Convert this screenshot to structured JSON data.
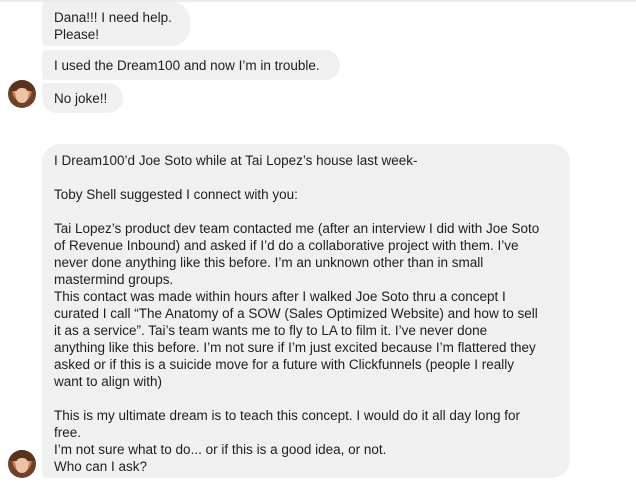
{
  "messages": [
    {
      "text": "Dana!!! I need help.\nPlease!"
    },
    {
      "text": "I used the Dream100 and now I’m in trouble."
    },
    {
      "text": "No joke!!"
    },
    {
      "text": "I Dream100’d Joe Soto while at Tai Lopez’s house last week-\n\nToby Shell suggested I connect with you:\n\nTai Lopez’s product dev team contacted me (after an interview I did with Joe Soto\nof Revenue Inbound) and asked if I’d do a collaborative project with them. I’ve\nnever done anything like this before. I’m an unknown other than in small\nmastermind groups.\nThis contact was made within hours after I walked Joe Soto thru a concept I\ncurated I call “The Anatomy of a SOW (Sales Optimized Website) and how to sell\nit as a service”. Tai’s team wants me to fly to LA to film it. I’ve never done\nanything like this before. I’m not sure if I’m just excited because I’m flattered they\nasked or if this is a suicide move for a future with Clickfunnels (people I really\nwant to align with)\n\nThis is my ultimate dream is to teach this concept. I would do it all day long for\nfree.\nI’m not sure what to do... or if this is a good idea, or not.\nWho can I ask?"
    }
  ]
}
